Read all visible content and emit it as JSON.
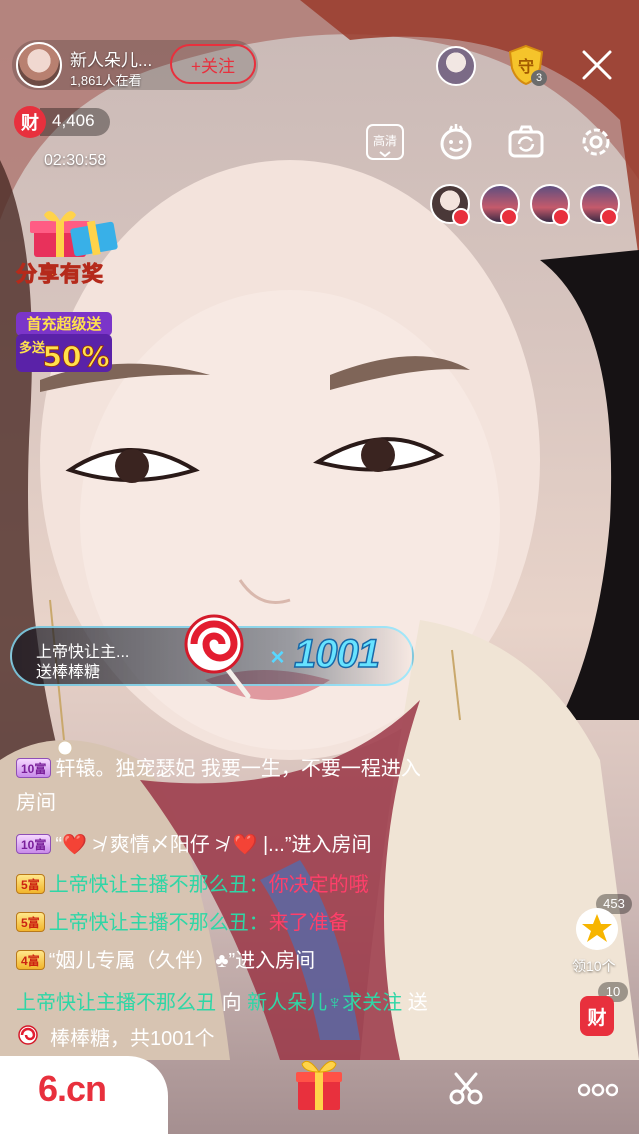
{
  "anchor": {
    "name": "新人朵儿...",
    "viewers": "1,861人在看",
    "follow_label": "+关注",
    "wealth_label": "财",
    "wealth_count": "4,406",
    "live_time": "02:30:58"
  },
  "promos": {
    "share": "分享有奖",
    "recharge_line1": "首充超级送",
    "recharge_line2": "多送",
    "recharge_pct": "50%"
  },
  "top_right": {
    "shield_label": "守",
    "shield_count": "3",
    "hd_label": "高清"
  },
  "gift_banner": {
    "sender": "上帝快让主...",
    "action": "送棒棒糖",
    "combo_prefix": "×",
    "combo_count": "1001"
  },
  "chat": {
    "line1_level": "10富",
    "line1_text": "轩辕。独宠瑟妃 我要一生，不要一程",
    "line1_suffix": "进入",
    "line1_tail": "房间",
    "line2_level": "10富",
    "line2_text": "“❤️ ≯ 爽情〆阳仔 ≯ ❤️ |...”进入房间",
    "line3_level": "5富",
    "line3_name": "上帝快让主播不那么丑：",
    "line3_msg": "你决定的哦",
    "line4_level": "5富",
    "line4_name": "上帝快让主播不那么丑：",
    "line4_msg": "来了准备",
    "line5_level": "4富",
    "line5_text": "“姻儿专属（久伴）♣”进入房间",
    "line6_name": "上帝快让主播不那么丑",
    "line6_to": "向",
    "line6_target": "新人朵儿♆求关注",
    "line6_send": "送",
    "line7_text": "棒棒糖，共1001个"
  },
  "side": {
    "star_count": "453",
    "star_label": "领10个",
    "wealth_count": "10",
    "wealth_label": "财"
  },
  "bottom": {
    "logo": "6.cn"
  },
  "colors": {
    "accent_red": "#e8303d",
    "chat_green": "#2fd6a6",
    "chat_pink": "#ff3f6a",
    "combo_blue": "#67e3ff"
  }
}
